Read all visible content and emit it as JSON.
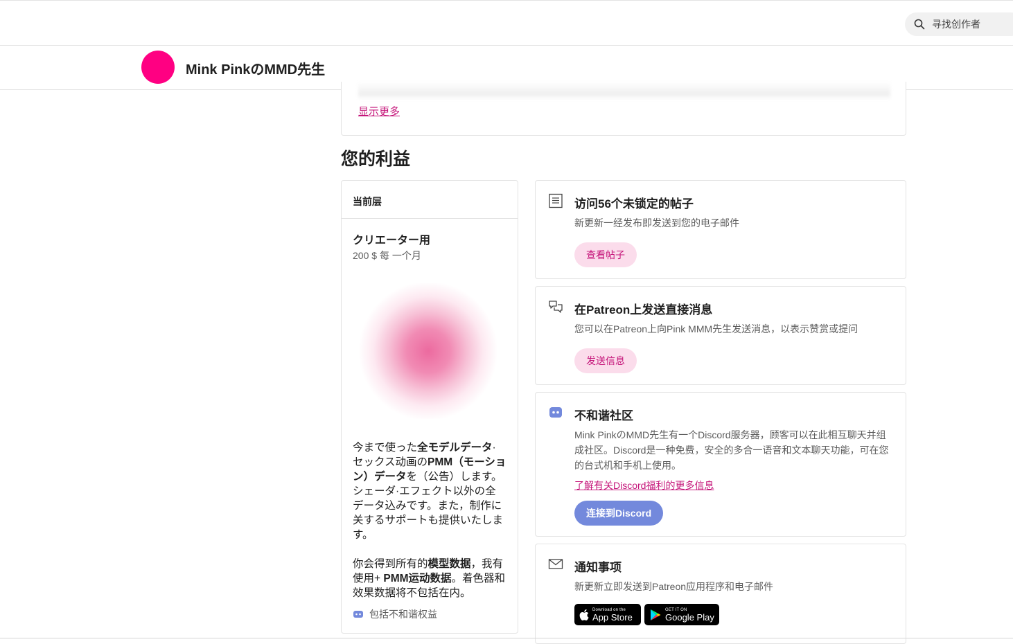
{
  "header": {
    "search_placeholder": "寻找创作者"
  },
  "creator": {
    "name": "Mink PinkのMMD先生",
    "avatar_color": "#ff0082"
  },
  "top_card": {
    "show_more": "显示更多"
  },
  "benefits_section": {
    "title": "您的利益"
  },
  "tier": {
    "header": "当前层",
    "name": "クリエーター用",
    "price": "200 $ 每 一个月",
    "desc1": {
      "a": "今まで使った",
      "b": "全モデルデータ",
      "c": "·セックス动画の",
      "d": "PMM（モーション）データ",
      "e": "を（公告）します。シェーダ·エフェクト以外の全データ込みです。また，制作に关するサポートも提供いたします。"
    },
    "desc2": {
      "a": "你会得到所有的",
      "b": "模型数据",
      "c": "，我有使用+ ",
      "d": "PMM运动数据",
      "e": "。着色器和效果数据将不包括在内。"
    },
    "discord_note": "包括不和谐权益"
  },
  "benefits": {
    "posts": {
      "title": "访问56个未锁定的帖子",
      "text": "新更新一经发布即发送到您的电子邮件",
      "button": "查看帖子"
    },
    "messages": {
      "title": "在Patreon上发送直接消息",
      "text": "您可以在Patreon上向Pink MMM先生发送消息，以表示赞赏或提问",
      "button": "发送信息"
    },
    "discord": {
      "title": "不和谐社区",
      "text": "Mink PinkのMMD先生有一个Discord服务器，顾客可以在此相互聊天并组成社区。Discord是一种免费，安全的多合一语音和文本聊天功能，可在您的台式机和手机上使用。",
      "link": "了解有关Discord福利的更多信息",
      "button": "连接到Discord",
      "button_color": "#7389dc"
    },
    "notifications": {
      "title": "通知事项",
      "text": "新更新立即发送到Patreon应用程序和电子邮件",
      "app_store_small": "Download on the",
      "app_store_big": "App Store",
      "google_small": "GET IT ON",
      "google_big": "Google Play"
    }
  },
  "colors": {
    "accent": "#c5157a",
    "pill_bg": "#fbdceb",
    "border": "#e3e3e3"
  }
}
